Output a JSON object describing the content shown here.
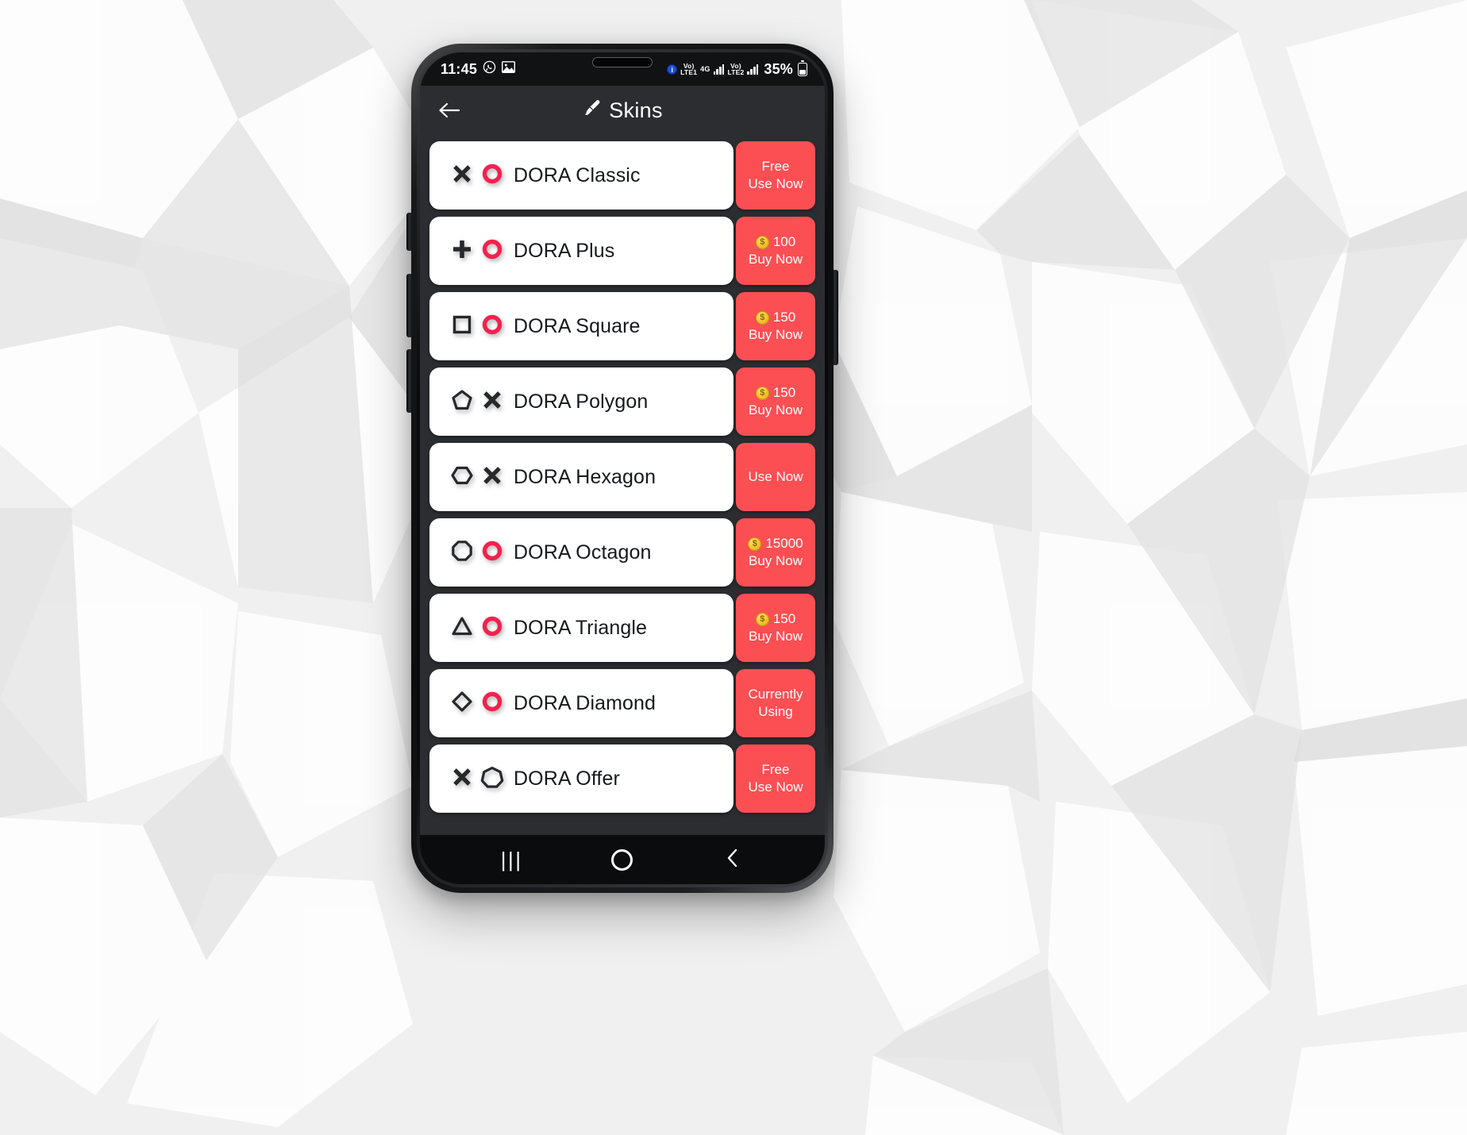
{
  "status_bar": {
    "time": "11:45",
    "left_icons": [
      "whatsapp-icon",
      "image-icon"
    ],
    "info_dot": "notification-dot-icon",
    "sim1": {
      "line1": "Vo)",
      "line2": "LTE1"
    },
    "network": "4G",
    "sim2": {
      "line1": "Vo)",
      "line2": "LTE2"
    },
    "battery_percent": "35%"
  },
  "app_bar": {
    "back_label": "back-arrow",
    "title": "Skins",
    "title_icon": "paintbrush-icon"
  },
  "colors": {
    "accent": "#fb4f53",
    "ring": "#f4214e",
    "coin": "#f2c028",
    "app_bg": "#2b2d31",
    "card_bg": "#ffffff",
    "text_dark": "#16181c"
  },
  "skins": [
    {
      "name": "DORA Classic",
      "icon_left": "cross-icon",
      "icon_right": "circle-ring-icon",
      "action": {
        "top": "Free",
        "bottom": "Use Now",
        "has_coin": false,
        "state": "free"
      }
    },
    {
      "name": "DORA Plus",
      "icon_left": "plus-icon",
      "icon_right": "circle-ring-icon",
      "action": {
        "top": "100",
        "bottom": "Buy Now",
        "has_coin": true,
        "state": "buy"
      }
    },
    {
      "name": "DORA Square",
      "icon_left": "square-icon",
      "icon_right": "circle-ring-icon",
      "action": {
        "top": "150",
        "bottom": "Buy Now",
        "has_coin": true,
        "state": "buy"
      }
    },
    {
      "name": "DORA Polygon",
      "icon_left": "pentagon-icon",
      "icon_right": "cross-icon",
      "action": {
        "top": "150",
        "bottom": "Buy Now",
        "has_coin": true,
        "state": "buy"
      }
    },
    {
      "name": "DORA Hexagon",
      "icon_left": "hexagon-icon",
      "icon_right": "cross-icon",
      "action": {
        "top": "",
        "bottom": "Use Now",
        "has_coin": false,
        "state": "owned"
      }
    },
    {
      "name": "DORA Octagon",
      "icon_left": "octagon-icon",
      "icon_right": "circle-ring-icon",
      "action": {
        "top": "15000",
        "bottom": "Buy Now",
        "has_coin": true,
        "state": "buy"
      }
    },
    {
      "name": "DORA Triangle",
      "icon_left": "triangle-icon",
      "icon_right": "circle-ring-icon",
      "action": {
        "top": "150",
        "bottom": "Buy Now",
        "has_coin": true,
        "state": "buy"
      }
    },
    {
      "name": "DORA Diamond",
      "icon_left": "diamond-icon",
      "icon_right": "circle-ring-icon",
      "action": {
        "top": "Currently",
        "bottom": "Using",
        "has_coin": false,
        "state": "current"
      }
    },
    {
      "name": "DORA Offer",
      "icon_left": "cross-icon",
      "icon_right": "heptagon-icon",
      "action": {
        "top": "Free",
        "bottom": "Use Now",
        "has_coin": false,
        "state": "free"
      }
    }
  ],
  "nav_bar": {
    "recents": "|||",
    "home": "home-circle-icon",
    "back": "back-chevron-icon"
  }
}
